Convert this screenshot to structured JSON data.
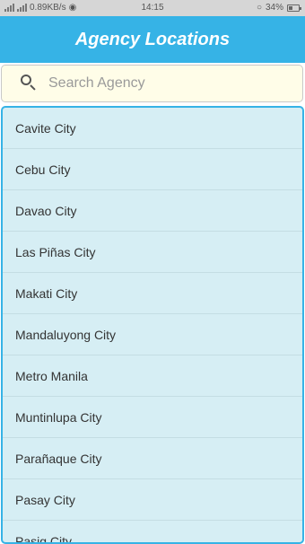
{
  "status_bar": {
    "network_speed": "0.89KB/s",
    "time": "14:15",
    "battery": "34%"
  },
  "header": {
    "title": "Agency Locations"
  },
  "search": {
    "placeholder": "Search Agency",
    "value": ""
  },
  "locations": [
    "Cavite City",
    "Cebu City",
    "Davao City",
    "Las Piñas City",
    "Makati City",
    "Mandaluyong City",
    "Metro Manila",
    "Muntinlupa City",
    "Parañaque City",
    "Pasay City",
    "Pasig City"
  ]
}
